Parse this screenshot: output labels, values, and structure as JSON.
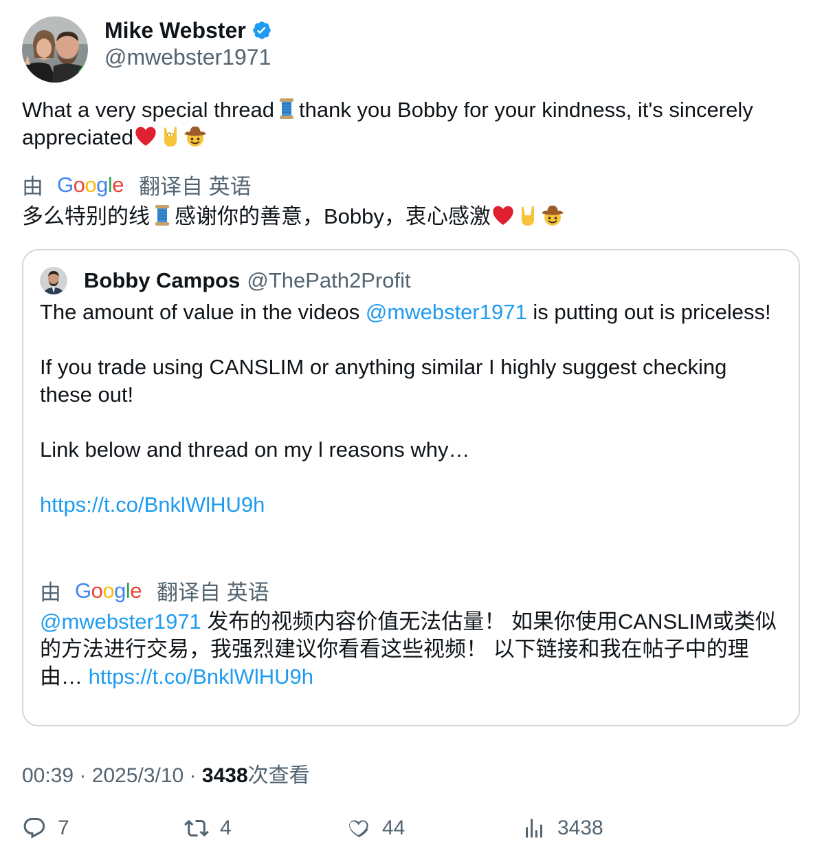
{
  "author": {
    "display_name": "Mike Webster",
    "handle": "@mwebster1971",
    "verified": true
  },
  "tweet": {
    "text_a": "What a very special thread",
    "text_b": "thank you Bobby for your kindness, it's sincerely appreciated",
    "emojis": [
      "spool-emoji",
      "red-heart-emoji",
      "sign-of-horns-emoji",
      "cowboy-face-emoji"
    ]
  },
  "translation": {
    "by_label": "由",
    "provider": "Google",
    "from_label": "翻译自 英语",
    "text_a": "多么特别的线",
    "text_b": "感谢你的善意，Bobby，衷心感激"
  },
  "quote": {
    "display_name": "Bobby Campos",
    "handle": "@ThePath2Profit",
    "line1_pre": "The amount of value in the videos ",
    "line1_mention": "@mwebster1971",
    "line1_post": " is putting out is priceless!",
    "line2": "If you trade using CANSLIM or anything similar I highly suggest checking these out!",
    "line3": "Link below and thread on my l reasons why…",
    "link": "https://t.co/BnklWlHU9h",
    "translation": {
      "by_label": "由",
      "provider": "Google",
      "from_label": "翻译自 英语",
      "mention": "@mwebster1971",
      "text": " 发布的视频内容价值无法估量！ 如果你使用CANSLIM或类似的方法进行交易，我强烈建议你看看这些视频！ 以下链接和我在帖子中的理由… ",
      "link": "https://t.co/BnklWlHU9h"
    }
  },
  "meta": {
    "time": "00:39",
    "sep": " · ",
    "date": "2025/3/10",
    "views": "3438",
    "views_label": "次查看"
  },
  "actions": {
    "replies": "7",
    "retweets": "4",
    "likes": "44",
    "views": "3438"
  },
  "colors": {
    "link": "#1d9bf0",
    "secondary_text": "#536471",
    "border": "#cfd9de",
    "verified": "#1d9bf0"
  }
}
